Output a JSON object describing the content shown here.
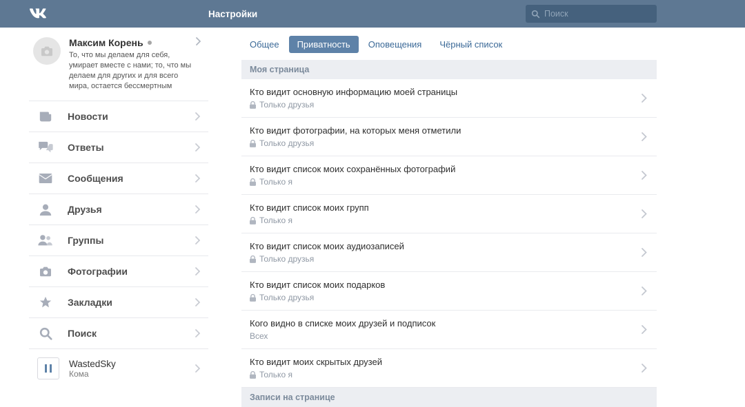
{
  "topbar": {
    "title": "Настройки",
    "search_placeholder": "Поиск"
  },
  "profile": {
    "name": "Максим Корень",
    "status": "То, что мы делаем для себя, умирает вместе с нами; то, что мы делаем для других и для всего мира, остается бессмертным"
  },
  "nav": [
    {
      "icon": "news",
      "label": "Новости"
    },
    {
      "icon": "replies",
      "label": "Ответы"
    },
    {
      "icon": "messages",
      "label": "Сообщения"
    },
    {
      "icon": "friends",
      "label": "Друзья"
    },
    {
      "icon": "groups",
      "label": "Группы"
    },
    {
      "icon": "photos",
      "label": "Фотографии"
    },
    {
      "icon": "bookmarks",
      "label": "Закладки"
    },
    {
      "icon": "search",
      "label": "Поиск"
    }
  ],
  "player": {
    "title": "WastedSky",
    "subtitle": "Кома"
  },
  "tabs": [
    {
      "id": "general",
      "label": "Общее",
      "active": false
    },
    {
      "id": "privacy",
      "label": "Приватность",
      "active": true
    },
    {
      "id": "notify",
      "label": "Оповещения",
      "active": false
    },
    {
      "id": "blacklist",
      "label": "Чёрный список",
      "active": false
    }
  ],
  "sections": [
    {
      "title": "Моя страница",
      "rows": [
        {
          "title": "Кто видит основную информацию моей страницы",
          "value": "Только друзья",
          "lock": true
        },
        {
          "title": "Кто видит фотографии, на которых меня отметили",
          "value": "Только друзья",
          "lock": true
        },
        {
          "title": "Кто видит список моих сохранённых фотографий",
          "value": "Только я",
          "lock": true
        },
        {
          "title": "Кто видит список моих групп",
          "value": "Только я",
          "lock": true
        },
        {
          "title": "Кто видит список моих аудиозаписей",
          "value": "Только друзья",
          "lock": true
        },
        {
          "title": "Кто видит список моих подарков",
          "value": "Только друзья",
          "lock": true
        },
        {
          "title": "Кого видно в списке моих друзей и подписок",
          "value": "Всех",
          "lock": false
        },
        {
          "title": "Кто видит моих скрытых друзей",
          "value": "Только я",
          "lock": true
        }
      ]
    },
    {
      "title": "Записи на странице",
      "rows": []
    }
  ]
}
